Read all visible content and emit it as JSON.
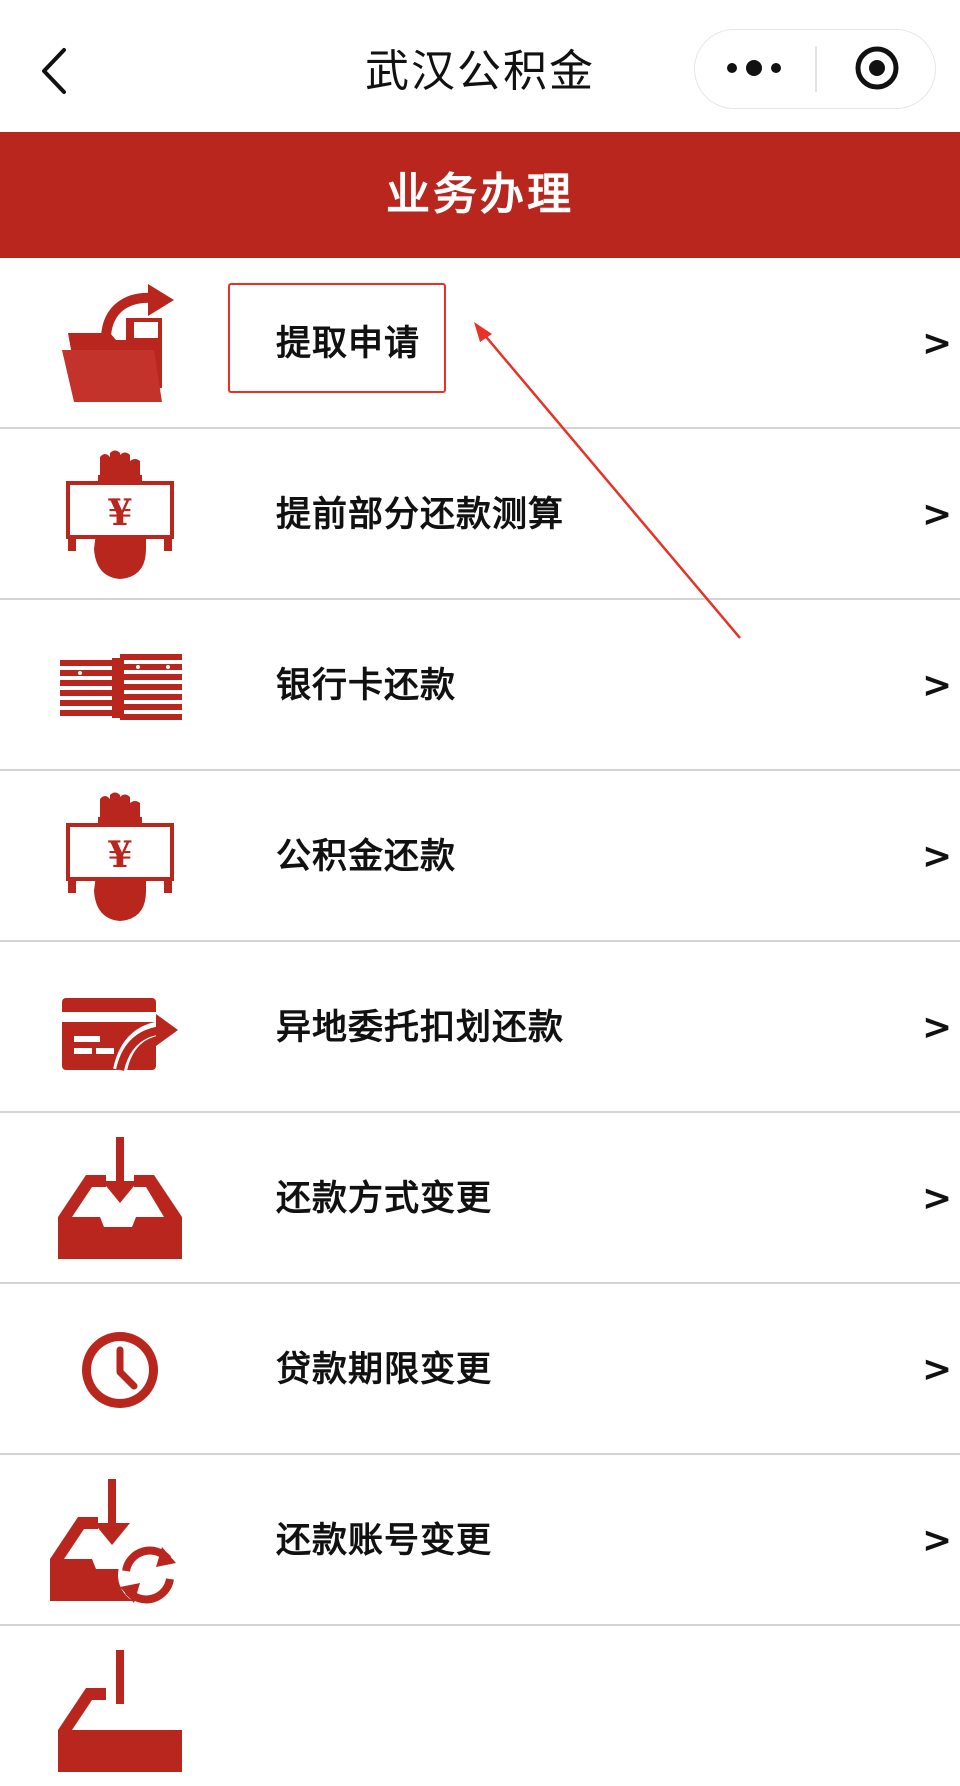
{
  "navbar": {
    "title": "武汉公积金",
    "back_icon": "chevron-left-icon",
    "more_icon": "more-dots-icon",
    "close_icon": "target-circle-icon"
  },
  "section": {
    "title": "业务办理"
  },
  "items": [
    {
      "label": "提取申请",
      "icon": "folder-arrow-icon",
      "chevron": ">"
    },
    {
      "label": "提前部分还款测算",
      "icon": "hand-yen-icon",
      "chevron": ">"
    },
    {
      "label": "银行卡还款",
      "icon": "cash-stack-icon",
      "chevron": ">"
    },
    {
      "label": "公积金还款",
      "icon": "hand-yen-icon",
      "chevron": ">"
    },
    {
      "label": "异地委托扣划还款",
      "icon": "card-transfer-icon",
      "chevron": ">"
    },
    {
      "label": "还款方式变更",
      "icon": "inbox-download-icon",
      "chevron": ">"
    },
    {
      "label": "贷款期限变更",
      "icon": "clock-icon",
      "chevron": ">"
    },
    {
      "label": "还款账号变更",
      "icon": "inbox-refresh-icon",
      "chevron": ">"
    }
  ],
  "annotation": {
    "highlight_target": "提取申请",
    "color": "#e63229"
  },
  "colors": {
    "brand_red": "#b8261e",
    "icon_red": "#b8261e",
    "annotation_red": "#e63229",
    "divider": "#d4d4d4"
  }
}
